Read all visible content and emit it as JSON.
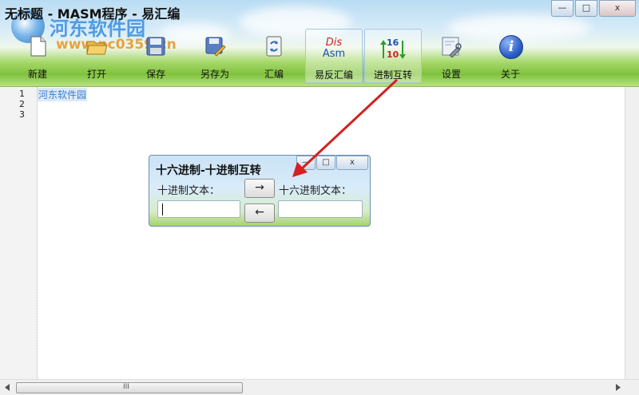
{
  "window": {
    "title": "无标题 - MASM程序 - 易汇编",
    "controls": {
      "minimize": "—",
      "maximize": "□",
      "close": "x"
    }
  },
  "watermark": {
    "name": "河东软件园",
    "url": "www.pc0359.cn"
  },
  "toolbar": {
    "items": [
      {
        "label": "新建",
        "icon": "new-file-icon"
      },
      {
        "label": "打开",
        "icon": "open-folder-icon"
      },
      {
        "label": "保存",
        "icon": "save-disk-icon"
      },
      {
        "label": "另存为",
        "icon": "save-as-icon"
      },
      {
        "label": "汇编",
        "icon": "assemble-icon"
      },
      {
        "label": "易反汇编",
        "icon": "disasm-icon",
        "icon_text_top": "Dis",
        "icon_text_bottom": "Asm"
      },
      {
        "label": "进制互转",
        "icon": "base-convert-icon",
        "icon_text_top": "16",
        "icon_text_bottom": "10"
      },
      {
        "label": "设置",
        "icon": "settings-icon"
      },
      {
        "label": "关于",
        "icon": "about-icon",
        "icon_text": "i"
      }
    ]
  },
  "editor": {
    "line_numbers": [
      "1",
      "2",
      "3"
    ],
    "lines": [
      "河东软件园",
      "",
      ""
    ]
  },
  "scrollbar": {
    "grip": "III"
  },
  "dialog": {
    "title": "十六进制-十进制互转",
    "controls": {
      "minimize": "—",
      "maximize": "□",
      "close": "x"
    },
    "decimal_label": "十进制文本：",
    "hex_label": "十六进制文本：",
    "to_hex_button": "→",
    "to_dec_button": "←",
    "decimal_value": "",
    "hex_value": ""
  },
  "colors": {
    "accent_blue": "#3a7fd0",
    "arrow_red": "#d42020",
    "grass_green": "#7fc23e"
  }
}
